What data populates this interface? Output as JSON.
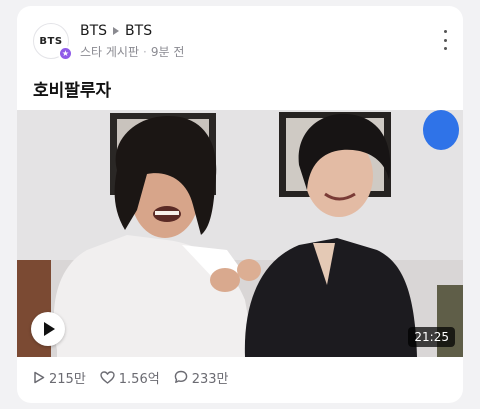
{
  "post": {
    "avatar_logo": "BTS",
    "breadcrumb": [
      "BTS",
      "BTS"
    ],
    "board": "스타 게시판",
    "time_ago": "9분 전",
    "title": "호비팔루자"
  },
  "video": {
    "duration": "21:25"
  },
  "stats": {
    "views": "215만",
    "likes": "1.56억",
    "comments": "233만"
  },
  "icons": {
    "badge": "star-icon",
    "more": "more-vertical-icon",
    "play": "play-icon",
    "views": "play-outline-icon",
    "likes": "heart-icon",
    "comments": "comment-icon"
  },
  "colors": {
    "badge": "#8f5be8",
    "overlay_dot": "#2f73e8"
  }
}
